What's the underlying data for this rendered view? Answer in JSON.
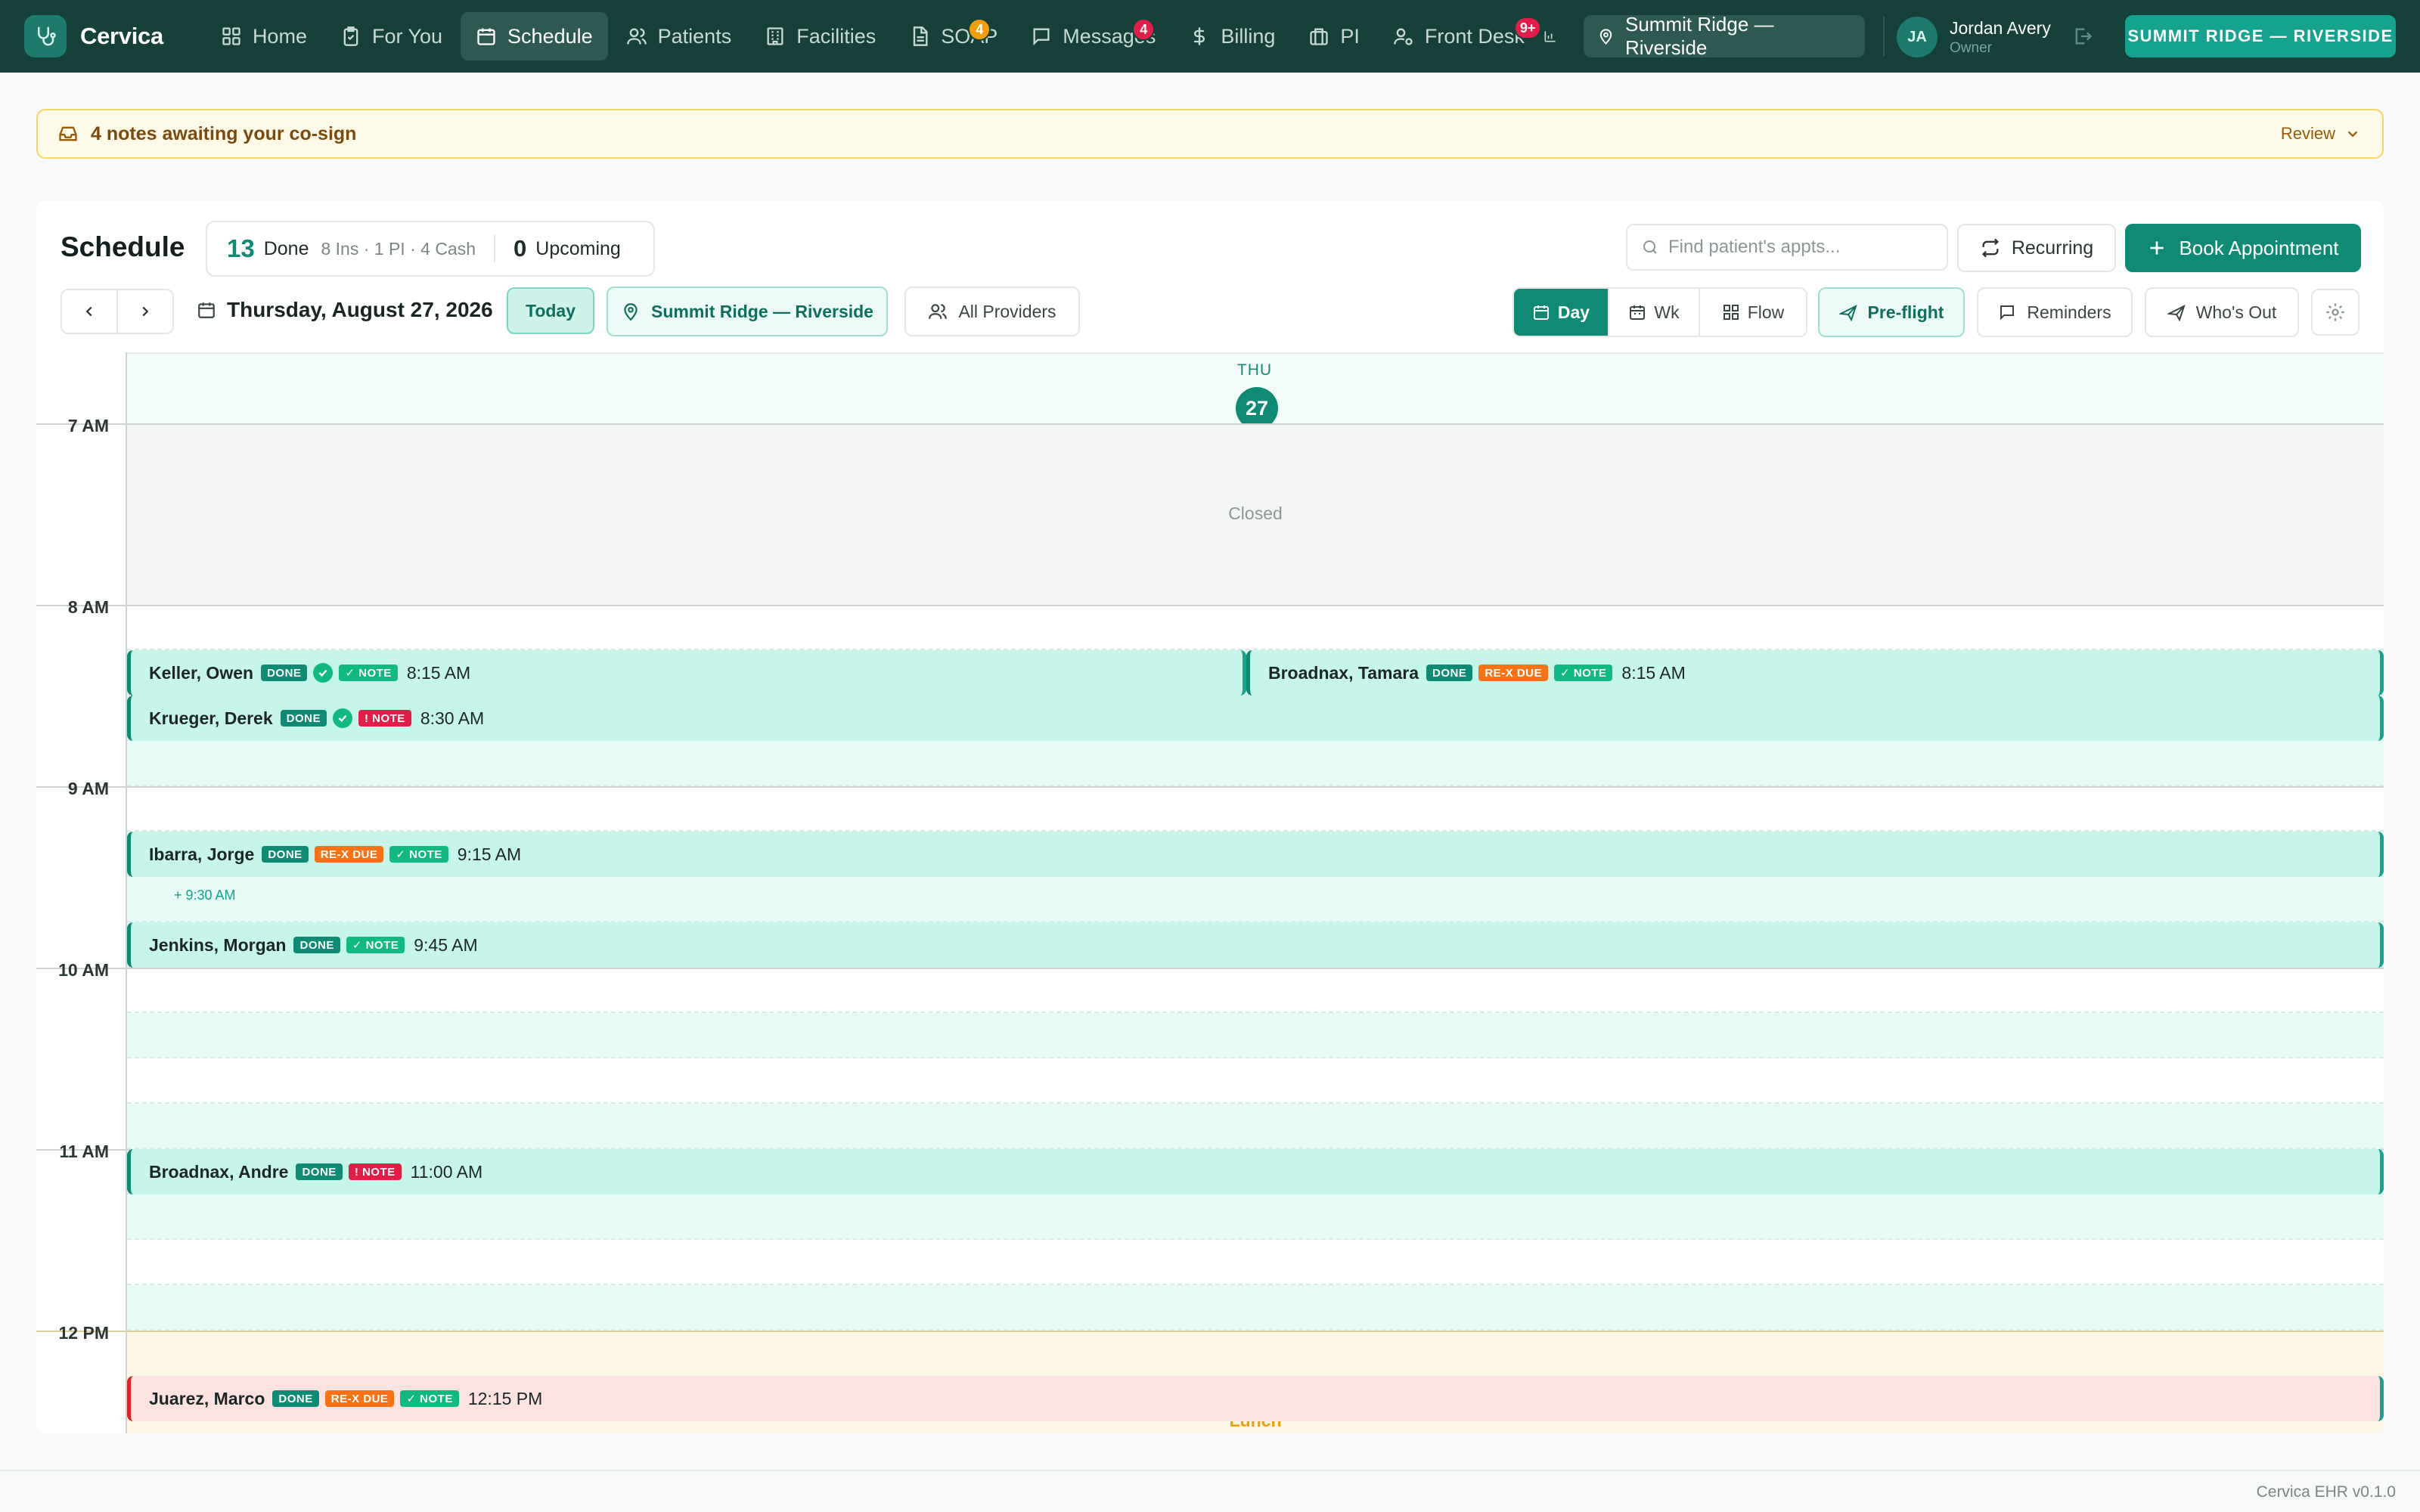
{
  "app": {
    "name": "Cervica",
    "version": "Cervica EHR v0.1.0"
  },
  "nav": {
    "items": [
      {
        "label": "Home",
        "icon": "home-icon",
        "badge": null
      },
      {
        "label": "For You",
        "icon": "clipboard-icon",
        "badge": null
      },
      {
        "label": "Schedule",
        "icon": "calendar-icon",
        "badge": null,
        "active": true
      },
      {
        "label": "Patients",
        "icon": "users-icon",
        "badge": null
      },
      {
        "label": "Facilities",
        "icon": "building-icon",
        "badge": null
      },
      {
        "label": "SOAP",
        "icon": "document-icon",
        "badge": "4"
      },
      {
        "label": "Messages",
        "icon": "chat-icon",
        "badge": "4"
      },
      {
        "label": "Billing",
        "icon": "dollar-icon",
        "badge": null
      },
      {
        "label": "PI",
        "icon": "briefcase-icon",
        "badge": null
      },
      {
        "label": "Front Desk",
        "icon": "user-cog-icon",
        "badge": "9+"
      }
    ],
    "location": "Summit Ridge — Riverside",
    "user_initials": "JA",
    "user_name": "Jordan Avery",
    "user_role": "Owner",
    "clinic_button": "SUMMIT RIDGE — RIVERSIDE"
  },
  "banner": {
    "text": "4 notes awaiting your co-sign",
    "action": "Review"
  },
  "schedule": {
    "title": "Schedule",
    "done_count": "13",
    "done_label": "Done",
    "done_breakdown": "8 Ins · 1 PI · 4 Cash",
    "upcoming_count": "0",
    "upcoming_label": "Upcoming",
    "search_placeholder": "Find patient's appts...",
    "recurring_label": "Recurring",
    "book_label": "Book Appointment",
    "date": "Thursday, August 27, 2026",
    "today_label": "Today",
    "location_chip": "Summit Ridge — Riverside",
    "providers_chip": "All Providers",
    "views": [
      "Day",
      "Wk",
      "Flow"
    ],
    "active_view": "Day",
    "preflight_label": "Pre-flight",
    "reminders_label": "Reminders",
    "whos_out_label": "Who's Out"
  },
  "calendar": {
    "day_of_week": "THU",
    "day_number": "27",
    "hours": [
      "7 AM",
      "8 AM",
      "9 AM",
      "10 AM",
      "11 AM",
      "12 PM"
    ],
    "closed_label": "Closed",
    "lunch_label": "Lunch",
    "add_slot_label": "+ 9:30 AM",
    "tags": {
      "done": "DONE",
      "rex": "RE-X DUE",
      "note_ok": "✓ NOTE",
      "note_missing": "! NOTE"
    },
    "appointments": [
      {
        "name": "Keller, Owen",
        "time": "8:15 AM",
        "tags": [
          "done",
          "check",
          "note_ok"
        ]
      },
      {
        "name": "Broadnax, Tamara",
        "time": "8:15 AM",
        "tags": [
          "done",
          "rex",
          "note_ok"
        ]
      },
      {
        "name": "Krueger, Derek",
        "time": "8:30 AM",
        "tags": [
          "done",
          "check",
          "note_missing"
        ]
      },
      {
        "name": "Ibarra, Jorge",
        "time": "9:15 AM",
        "tags": [
          "done",
          "rex",
          "note_ok"
        ]
      },
      {
        "name": "Jenkins, Morgan",
        "time": "9:45 AM",
        "tags": [
          "done",
          "note_ok"
        ]
      },
      {
        "name": "Broadnax, Andre",
        "time": "11:00 AM",
        "tags": [
          "done",
          "note_missing"
        ]
      },
      {
        "name": "Juarez, Marco",
        "time": "12:15 PM",
        "tags": [
          "done",
          "rex",
          "note_ok"
        ]
      }
    ]
  }
}
